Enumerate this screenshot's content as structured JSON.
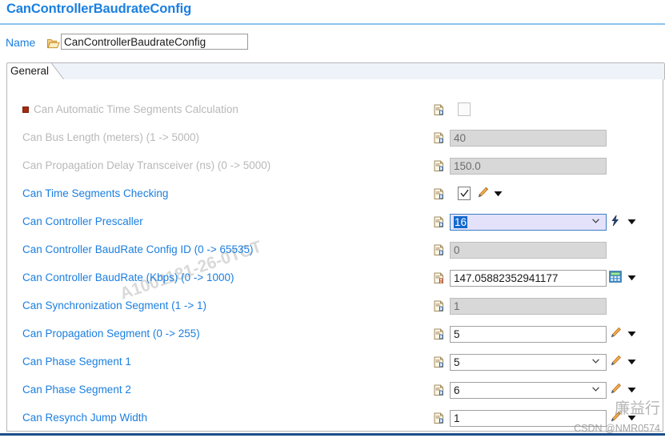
{
  "header": {
    "title": "CanControllerBaudrateConfig",
    "accent_color": "#1b7fe0",
    "rule_color": "#8cc4ee"
  },
  "name_row": {
    "label": "Name",
    "value": "CanControllerBaudrateConfig",
    "folder_icon": "open-folder-icon"
  },
  "tabs": [
    {
      "label": "General",
      "selected": true
    }
  ],
  "watermarks": {
    "diagonal": "A1001181-26-0TCT",
    "cn_text": "廉益行",
    "csdn": "CSDN @NMR0574"
  },
  "rows": [
    {
      "label": "Can Automatic Time Segments Calculation",
      "type": "checkbox",
      "checked": false,
      "enabled": false,
      "bullet": "red-square",
      "param_icon": "param-doc-icon"
    },
    {
      "label": "Can Bus Length (meters) (1 -> 5000)",
      "type": "text",
      "value": "40",
      "enabled": false,
      "param_icon": "param-doc-icon"
    },
    {
      "label": "Can Propagation Delay Transceiver (ns) (0 -> 5000)",
      "type": "text",
      "value": "150.0",
      "enabled": false,
      "param_icon": "param-doc-icon"
    },
    {
      "label": "Can Time Segments Checking",
      "type": "checkbox",
      "checked": true,
      "enabled": true,
      "param_icon": "param-doc-icon",
      "adornments": [
        "pencil-icon",
        "dropdown-arrow-icon"
      ]
    },
    {
      "label": "Can Controller Prescaller",
      "type": "combo",
      "value": "16",
      "enabled": true,
      "focused": true,
      "param_icon": "param-doc-icon",
      "adornments": [
        "lightning-icon",
        "dropdown-arrow-icon"
      ]
    },
    {
      "label": "Can Controller BaudRate Config ID (0 -> 65535)",
      "type": "text",
      "value": "0",
      "enabled": false,
      "param_icon": "param-doc-icon"
    },
    {
      "label": "Can Controller BaudRate (Kbps) (0 -> 1000)",
      "type": "text",
      "value": "147.05882352941177",
      "enabled": true,
      "param_icon": "param-doc-icon",
      "adornments": [
        "calculator-icon",
        "dropdown-arrow-icon"
      ]
    },
    {
      "label": "Can Synchronization Segment (1 -> 1)",
      "type": "text",
      "value": "1",
      "enabled": false,
      "param_icon": "param-doc-icon"
    },
    {
      "label": "Can Propagation Segment (0 -> 255)",
      "type": "text",
      "value": "5",
      "enabled": true,
      "param_icon": "param-doc-icon",
      "adornments": [
        "pencil-icon",
        "dropdown-arrow-icon"
      ]
    },
    {
      "label": "Can Phase Segment 1",
      "type": "combo",
      "value": "5",
      "enabled": true,
      "param_icon": "param-doc-icon",
      "adornments": [
        "pencil-icon",
        "dropdown-arrow-icon"
      ]
    },
    {
      "label": "Can Phase Segment 2",
      "type": "combo",
      "value": "6",
      "enabled": true,
      "param_icon": "param-doc-icon",
      "adornments": [
        "pencil-icon",
        "dropdown-arrow-icon"
      ]
    },
    {
      "label": "Can Resynch Jump Width",
      "type": "text",
      "value": "1",
      "enabled": true,
      "param_icon": "param-doc-icon",
      "adornments": [
        "pencil-icon",
        "dropdown-arrow-icon"
      ]
    }
  ]
}
